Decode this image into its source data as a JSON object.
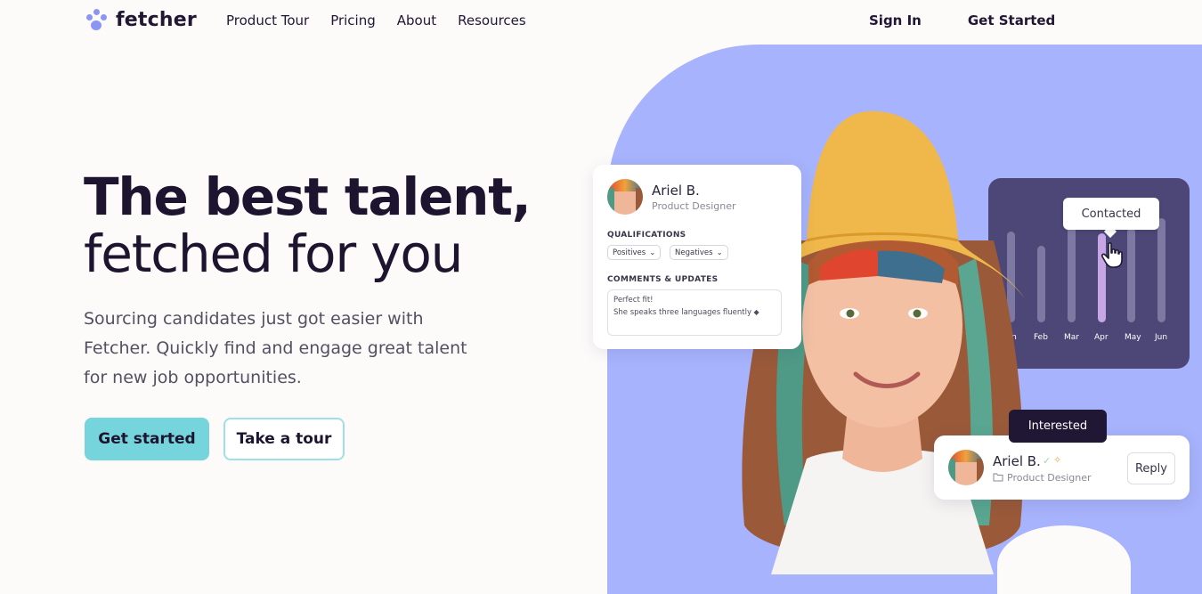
{
  "brand": {
    "name": "fetcher",
    "accent": "#8c95f5"
  },
  "nav": {
    "links": [
      "Product Tour",
      "Pricing",
      "About",
      "Resources"
    ],
    "sign_in": "Sign In",
    "get_started": "Get Started"
  },
  "hero": {
    "title_bold": "The best talent,",
    "title_light": "fetched for you",
    "subtitle": "Sourcing candidates just got easier with Fetcher. Quickly find and engage great talent for new job opportunities.",
    "primary_cta": "Get started",
    "secondary_cta": "Take a tour"
  },
  "profile_card": {
    "name": "Ariel B.",
    "role": "Product Designer",
    "qualifications_label": "QUALIFICATIONS",
    "positives": "Positives",
    "negatives": "Negatives",
    "comments_label": "COMMENTS & UPDATES",
    "comment_line1": "Perfect fit!",
    "comment_line2": "She speaks three languages fluently"
  },
  "chart_panel": {
    "tooltip": "Contacted",
    "months": [
      "Jan",
      "Feb",
      "Mar",
      "Apr",
      "May",
      "Jun"
    ]
  },
  "reply_card": {
    "tag": "Interested",
    "name": "Ariel B.",
    "role": "Product Designer",
    "reply": "Reply"
  },
  "colors": {
    "blob": "#a7b3fc",
    "cta": "#76d4dc",
    "panel": "#4c4776",
    "dark": "#1f1733"
  }
}
